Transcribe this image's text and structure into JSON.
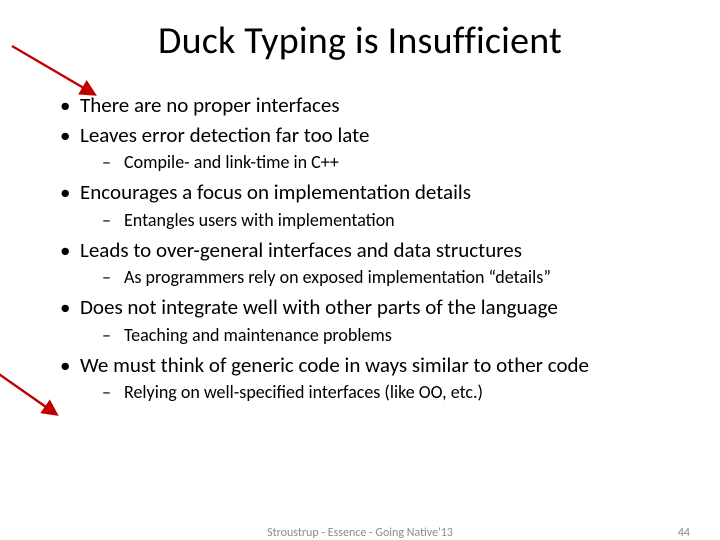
{
  "title": "Duck Typing is Insufficient",
  "bullets": [
    {
      "text": "There are no proper interfaces",
      "subs": []
    },
    {
      "text": "Leaves error detection far too late",
      "subs": [
        {
          "text": "Compile- and link-time in C++"
        }
      ]
    },
    {
      "text": "Encourages a focus on implementation details",
      "subs": [
        {
          "text": "Entangles users with implementation"
        }
      ]
    },
    {
      "text": "Leads to over-general interfaces and data structures",
      "subs": [
        {
          "text": "As programmers rely on exposed implementation “details”"
        }
      ]
    },
    {
      "text": "Does not integrate well with other parts of the language",
      "subs": [
        {
          "text": "Teaching and maintenance problems"
        }
      ]
    },
    {
      "text": "We must think of generic code in ways similar to other code",
      "subs": [
        {
          "text": "Relying on well-specified interfaces (like OO, etc.)"
        }
      ]
    }
  ],
  "footer": {
    "center": "Stroustrup - Essence - Going Native'13",
    "number": "44"
  },
  "arrow_color": "#c00000"
}
